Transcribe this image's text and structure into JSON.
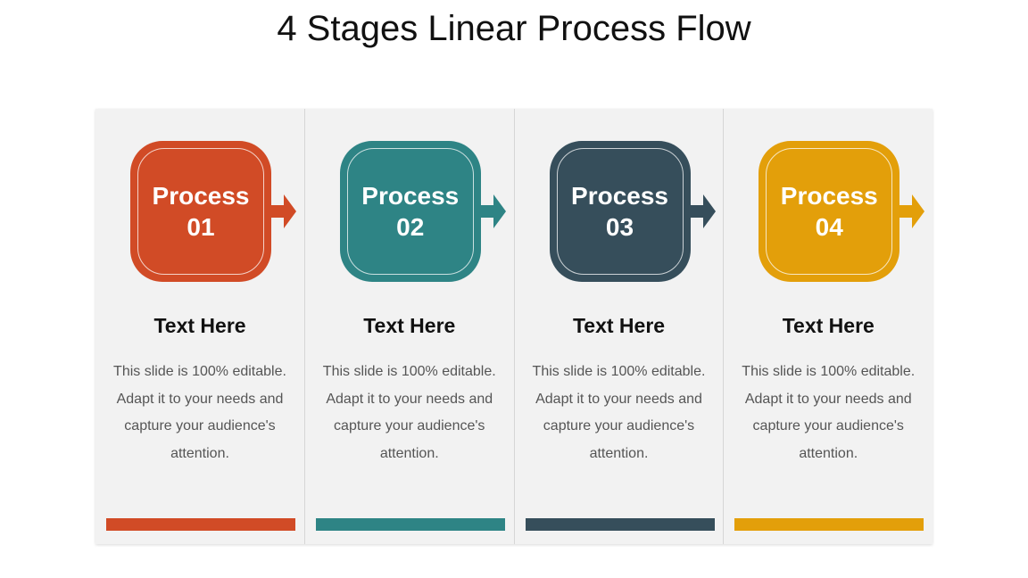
{
  "title": "4 Stages Linear Process Flow",
  "stages": [
    {
      "label_line1": "Process",
      "label_line2": "01",
      "color": "#d14b26",
      "heading": "Text Here",
      "description": "This slide is 100% editable. Adapt it to your needs and capture your audience's attention."
    },
    {
      "label_line1": "Process",
      "label_line2": "02",
      "color": "#2e8485",
      "heading": "Text Here",
      "description": "This slide is 100% editable. Adapt it to your needs and capture your audience's attention."
    },
    {
      "label_line1": "Process",
      "label_line2": "03",
      "color": "#364e5b",
      "heading": "Text Here",
      "description": "This slide is 100% editable. Adapt it to your needs and capture your audience's attention."
    },
    {
      "label_line1": "Process",
      "label_line2": "04",
      "color": "#e39f0a",
      "heading": "Text Here",
      "description": "This slide is 100% editable. Adapt it to your needs and capture your audience's attention."
    }
  ]
}
